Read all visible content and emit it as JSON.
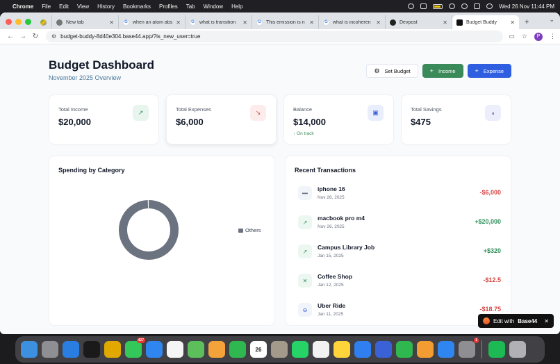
{
  "menubar": {
    "app": "Chrome",
    "items": [
      "File",
      "Edit",
      "View",
      "History",
      "Bookmarks",
      "Profiles",
      "Tab",
      "Window",
      "Help"
    ],
    "clock": "Wed 26 Nov  11:44 PM"
  },
  "browser": {
    "tabs": [
      {
        "label": "",
        "favicon": "drive"
      },
      {
        "label": "New tab",
        "favicon": "chrome"
      },
      {
        "label": "when an atom abs",
        "favicon": "google"
      },
      {
        "label": "what is transition",
        "favicon": "google"
      },
      {
        "label": "This emission is n",
        "favicon": "google"
      },
      {
        "label": "what is incoheren",
        "favicon": "google"
      },
      {
        "label": "Devpost",
        "favicon": "github"
      },
      {
        "label": "Budget Buddy",
        "favicon": "budget-buddy",
        "active": true
      }
    ],
    "url": "budget-buddy-8d40e304.base44.app/?is_new_user=true",
    "profile_initial": "P"
  },
  "header": {
    "title": "Budget Dashboard",
    "subtitle": "November 2025 Overview",
    "set_budget_label": "Set Budget",
    "income_label": "Income",
    "expense_label": "Expense"
  },
  "stats": [
    {
      "label": "Total Income",
      "value": "$20,000",
      "icon": "trending-up-icon",
      "color": "#2f8f5a"
    },
    {
      "label": "Total Expenses",
      "value": "$6,000",
      "icon": "trending-down-icon",
      "color": "#d64545"
    },
    {
      "label": "Balance",
      "value": "$14,000",
      "note": "↑ On track",
      "icon": "wallet-icon",
      "color": "#3b5fd9"
    },
    {
      "label": "Total Savings",
      "value": "$475",
      "icon": "piggy-bank-icon",
      "color": "#4b56c9"
    }
  ],
  "spending": {
    "title": "Spending by Category",
    "legend": [
      {
        "name": "Others",
        "color": "#6b7280"
      }
    ]
  },
  "chart_data": {
    "type": "pie",
    "donut": true,
    "categories": [
      "Others"
    ],
    "values": [
      6000
    ],
    "colors": [
      "#6b7280"
    ],
    "legend_position": "right"
  },
  "transactions": {
    "title": "Recent Transactions",
    "items": [
      {
        "name": "iphone 16",
        "date": "Nov 26, 2025",
        "amount": "-$6,000",
        "type": "expense",
        "icon": "more-icon"
      },
      {
        "name": "macbook pro m4",
        "date": "Nov 26, 2025",
        "amount": "+$20,000",
        "type": "income",
        "icon": "trending-up-icon"
      },
      {
        "name": "Campus Library Job",
        "date": "Jan 15, 2025",
        "amount": "+$320",
        "type": "income",
        "icon": "trending-up-icon"
      },
      {
        "name": "Coffee Shop",
        "date": "Jan 12, 2025",
        "amount": "-$12.5",
        "type": "expense",
        "icon": "utensils-icon"
      },
      {
        "name": "Uber Ride",
        "date": "Jan 11, 2025",
        "amount": "-$18.75",
        "type": "expense",
        "icon": "car-icon"
      }
    ]
  },
  "toast": {
    "prefix": "Edit with",
    "brand": "Base44"
  },
  "dock": {
    "apps": [
      {
        "name": "finder",
        "color": "#3d8fe0"
      },
      {
        "name": "launchpad",
        "color": "#8e8e93"
      },
      {
        "name": "safari",
        "color": "#2a7de1"
      },
      {
        "name": "cursor",
        "color": "#1a1a1a"
      },
      {
        "name": "chrome",
        "color": "#e0a800"
      },
      {
        "name": "messages",
        "color": "#34c759",
        "badge": "427"
      },
      {
        "name": "mail",
        "color": "#2f86f0"
      },
      {
        "name": "freeform",
        "color": "#f5f5f5"
      },
      {
        "name": "maps",
        "color": "#5cbf5c"
      },
      {
        "name": "photos",
        "color": "#f4a23a"
      },
      {
        "name": "facetime",
        "color": "#2fb84f"
      },
      {
        "name": "calendar",
        "color": "#ffffff",
        "text": "26"
      },
      {
        "name": "contacts",
        "color": "#a39a8c"
      },
      {
        "name": "whatsapp",
        "color": "#25d366"
      },
      {
        "name": "reminders",
        "color": "#f2f2f2"
      },
      {
        "name": "notes",
        "color": "#ffd43b"
      },
      {
        "name": "keynote",
        "color": "#2f7ff0"
      },
      {
        "name": "simulator",
        "color": "#3a62d6"
      },
      {
        "name": "numbers",
        "color": "#2fb84f"
      },
      {
        "name": "pages",
        "color": "#f39c32"
      },
      {
        "name": "app-store",
        "color": "#2f86f0"
      },
      {
        "name": "system-settings",
        "color": "#8e8e93",
        "badge": "1"
      },
      {
        "name": "spotify",
        "color": "#1db954"
      },
      {
        "name": "trash",
        "color": "#b0b0b5"
      }
    ]
  }
}
